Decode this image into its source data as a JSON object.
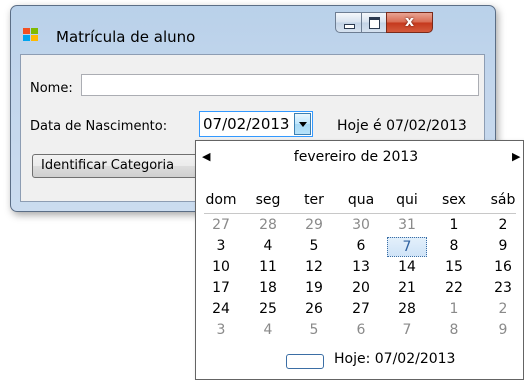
{
  "window": {
    "title": "Matrícula de aluno",
    "close_glyph": "x",
    "icon": "windows-form-icon"
  },
  "form": {
    "nome_label": "Nome:",
    "nome_value": "",
    "data_label": "Data de Nascimento:",
    "date_value": "07/02/2013",
    "hoje_text": "Hoje é 07/02/2013",
    "identificar_label": "Identificar Categoria"
  },
  "calendar": {
    "month_title": "fevereiro de 2013",
    "prev_glyph": "◀",
    "next_glyph": "▶",
    "weekdays": [
      "dom",
      "seg",
      "ter",
      "qua",
      "qui",
      "sex",
      "sáb"
    ],
    "weeks": [
      [
        {
          "d": "27",
          "other": true
        },
        {
          "d": "28",
          "other": true
        },
        {
          "d": "29",
          "other": true
        },
        {
          "d": "30",
          "other": true
        },
        {
          "d": "31",
          "other": true
        },
        {
          "d": "1"
        },
        {
          "d": "2"
        }
      ],
      [
        {
          "d": "3"
        },
        {
          "d": "4"
        },
        {
          "d": "5"
        },
        {
          "d": "6"
        },
        {
          "d": "7",
          "selected": true
        },
        {
          "d": "8"
        },
        {
          "d": "9"
        }
      ],
      [
        {
          "d": "10"
        },
        {
          "d": "11"
        },
        {
          "d": "12"
        },
        {
          "d": "13"
        },
        {
          "d": "14"
        },
        {
          "d": "15"
        },
        {
          "d": "16"
        }
      ],
      [
        {
          "d": "17"
        },
        {
          "d": "18"
        },
        {
          "d": "19"
        },
        {
          "d": "20"
        },
        {
          "d": "21"
        },
        {
          "d": "22"
        },
        {
          "d": "23"
        }
      ],
      [
        {
          "d": "24"
        },
        {
          "d": "25"
        },
        {
          "d": "26"
        },
        {
          "d": "27"
        },
        {
          "d": "28"
        },
        {
          "d": "1",
          "other": true
        },
        {
          "d": "2",
          "other": true
        }
      ],
      [
        {
          "d": "3",
          "other": true
        },
        {
          "d": "4",
          "other": true
        },
        {
          "d": "5",
          "other": true
        },
        {
          "d": "6",
          "other": true
        },
        {
          "d": "7",
          "other": true
        },
        {
          "d": "8",
          "other": true
        },
        {
          "d": "9",
          "other": true
        }
      ]
    ],
    "today_label": "Hoje: 07/02/2013"
  },
  "colors": {
    "window_frame": "#b9d1ea",
    "client_bg": "#f0f0f0",
    "selection_border": "#3b6ea5",
    "close_button": "#c4381c",
    "other_month_day": "#8a8a8a"
  }
}
